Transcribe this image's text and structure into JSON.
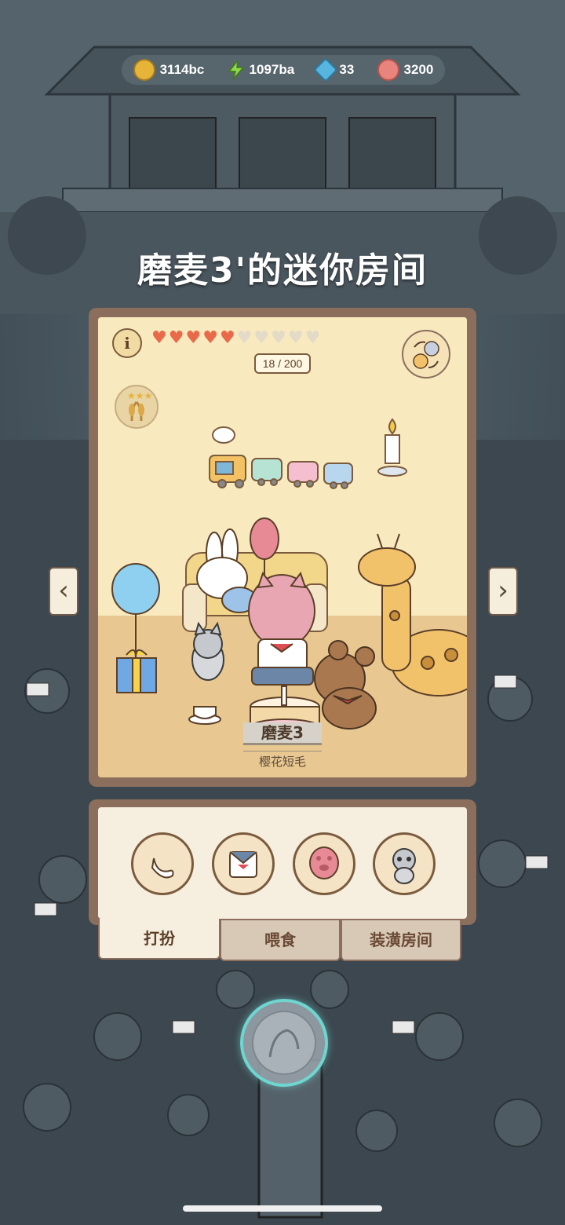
{
  "resources": [
    {
      "icon": "coin-icon",
      "value": "3114bc"
    },
    {
      "icon": "energy-icon",
      "value": "1097ba"
    },
    {
      "icon": "gem-icon",
      "value": "33"
    },
    {
      "icon": "paw-icon",
      "value": "3200"
    }
  ],
  "room": {
    "title": "磨麦3'的迷你房间",
    "info_label": "i",
    "hearts_total": 10,
    "hearts_filled": 5,
    "progress": "18 / 200",
    "cat_name": "磨麦3",
    "cat_breed": "樱花短毛",
    "prev_arrow": "‹",
    "next_arrow": "›"
  },
  "tabs": [
    {
      "label": "打扮",
      "active": true
    },
    {
      "label": "喂食",
      "active": false
    },
    {
      "label": "装潢房间",
      "active": false
    }
  ],
  "colors": {
    "heart": "#e96a4a",
    "frame": "#8b6e5c",
    "glow": "#6fd5cf"
  }
}
